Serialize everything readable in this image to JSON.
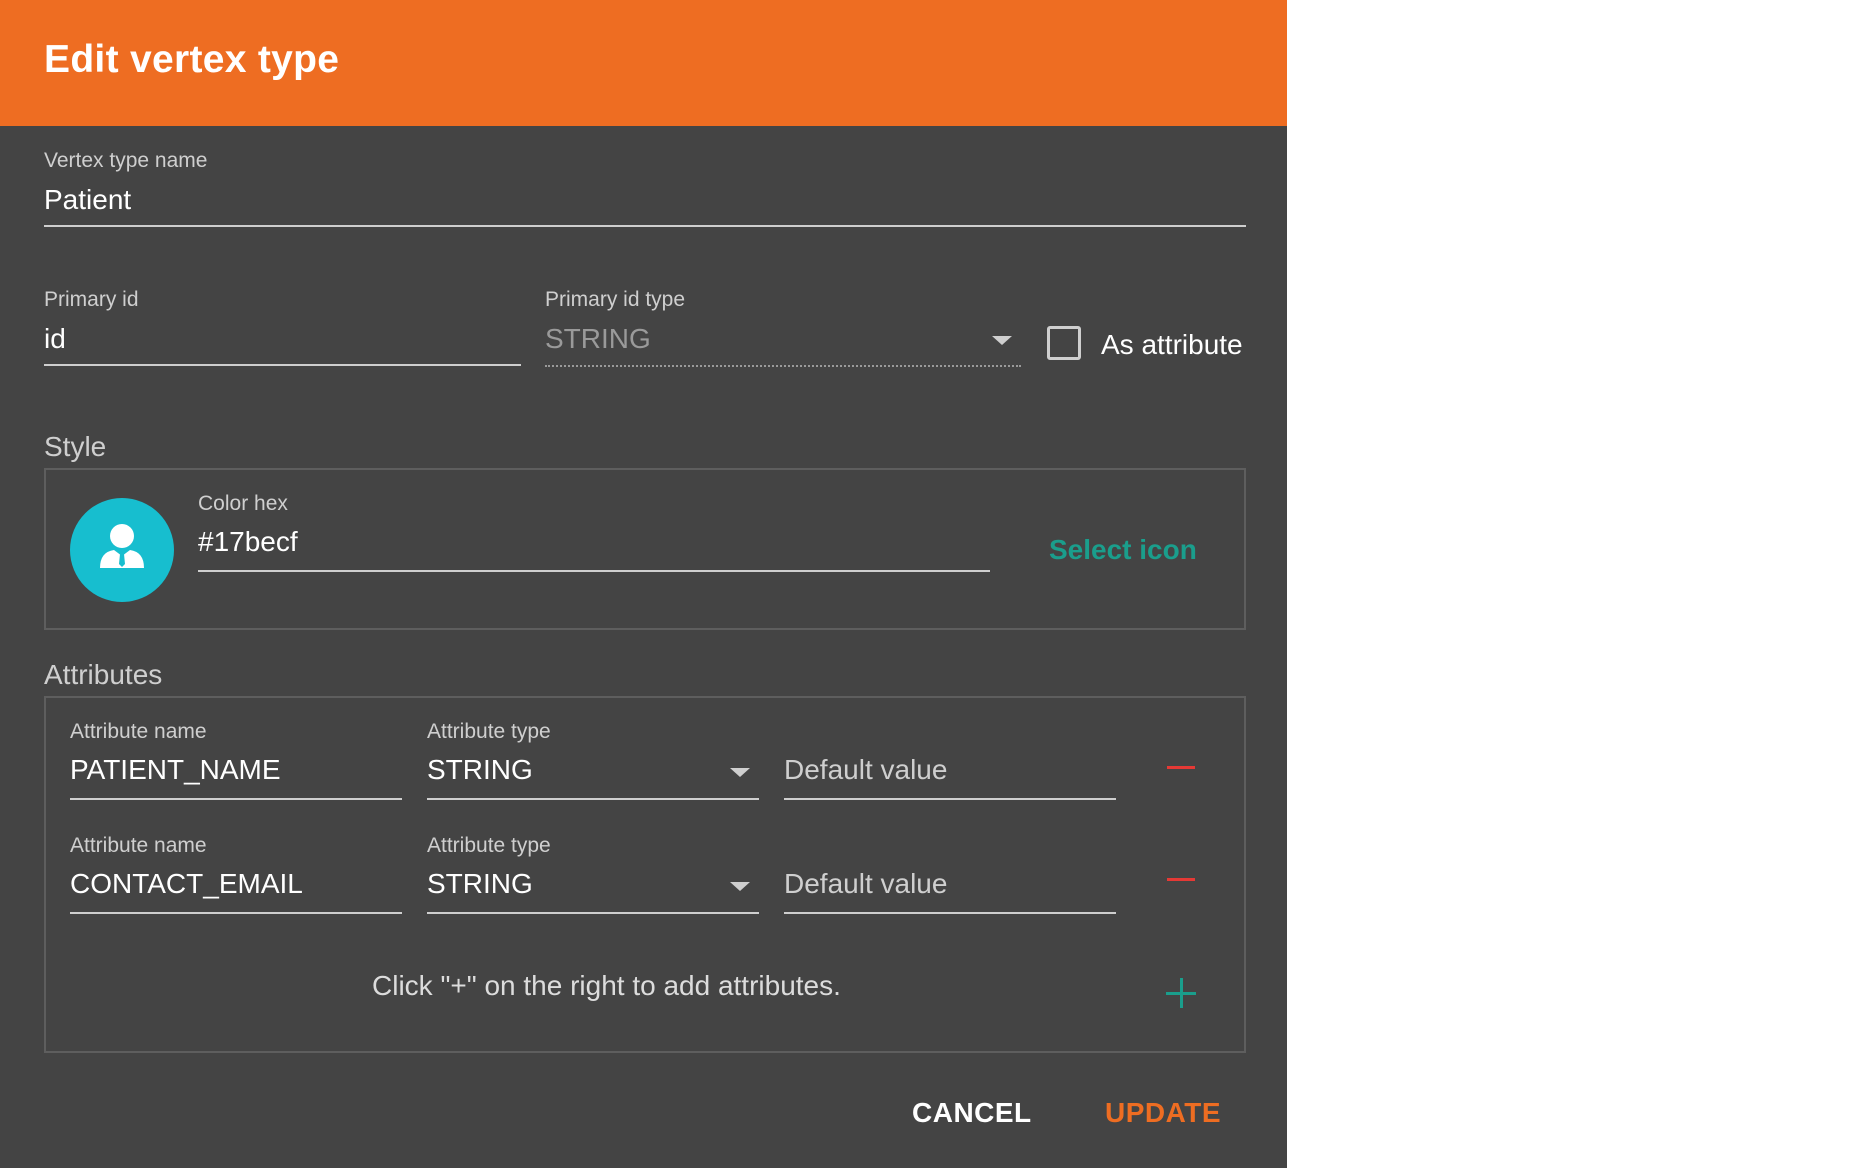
{
  "dialog": {
    "title": "Edit vertex type",
    "header_color": "#ee6d22",
    "background_color": "#444444"
  },
  "vertex_type_name": {
    "label": "Vertex type name",
    "value": "Patient"
  },
  "primary_id": {
    "label": "Primary id",
    "value": "id"
  },
  "primary_id_type": {
    "label": "Primary id type",
    "value": "STRING",
    "disabled": true
  },
  "as_attribute": {
    "label": "As attribute",
    "checked": false
  },
  "style": {
    "title": "Style",
    "color_hex_label": "Color hex",
    "color_hex_value": "#17becf",
    "icon": "person-icon",
    "select_icon_label": "Select icon"
  },
  "attributes": {
    "title": "Attributes",
    "rows": [
      {
        "name_label": "Attribute name",
        "name_value": "PATIENT_NAME",
        "type_label": "Attribute type",
        "type_value": "STRING",
        "default_placeholder": "Default value"
      },
      {
        "name_label": "Attribute name",
        "name_value": "CONTACT_EMAIL",
        "type_label": "Attribute type",
        "type_value": "STRING",
        "default_placeholder": "Default value"
      }
    ],
    "hint": "Click \"+\" on the right to add attributes."
  },
  "actions": {
    "cancel_label": "CANCEL",
    "update_label": "UPDATE",
    "accent_color": "#ee6d22",
    "link_color": "#1a9e8c",
    "remove_color": "#e53935"
  }
}
